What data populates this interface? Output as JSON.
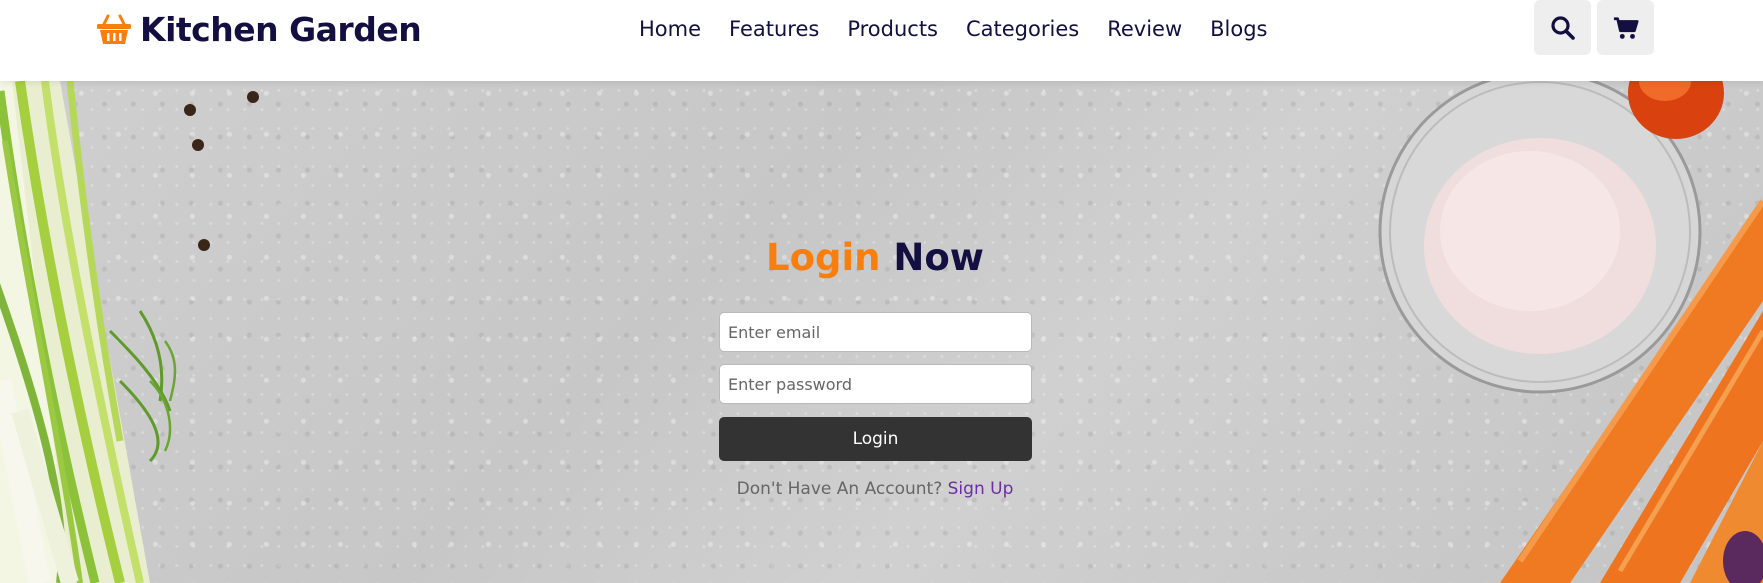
{
  "header": {
    "logo_text": "Kitchen Garden",
    "logo_icon": "basket-icon",
    "nav": [
      "Home",
      "Features",
      "Products",
      "Categories",
      "Review",
      "Blogs"
    ],
    "actions": [
      {
        "icon": "search-icon"
      },
      {
        "icon": "cart-icon"
      }
    ]
  },
  "login": {
    "title_accent": "Login",
    "title_rest": "Now",
    "email_placeholder": "Enter email",
    "password_placeholder": "Enter password",
    "button_label": "Login",
    "signup_prompt": "Don't Have An Account?",
    "signup_link": "Sign Up"
  },
  "colors": {
    "accent": "#f87f0e",
    "dark": "#130f40",
    "button": "#333333",
    "link": "#6b2fa3"
  }
}
